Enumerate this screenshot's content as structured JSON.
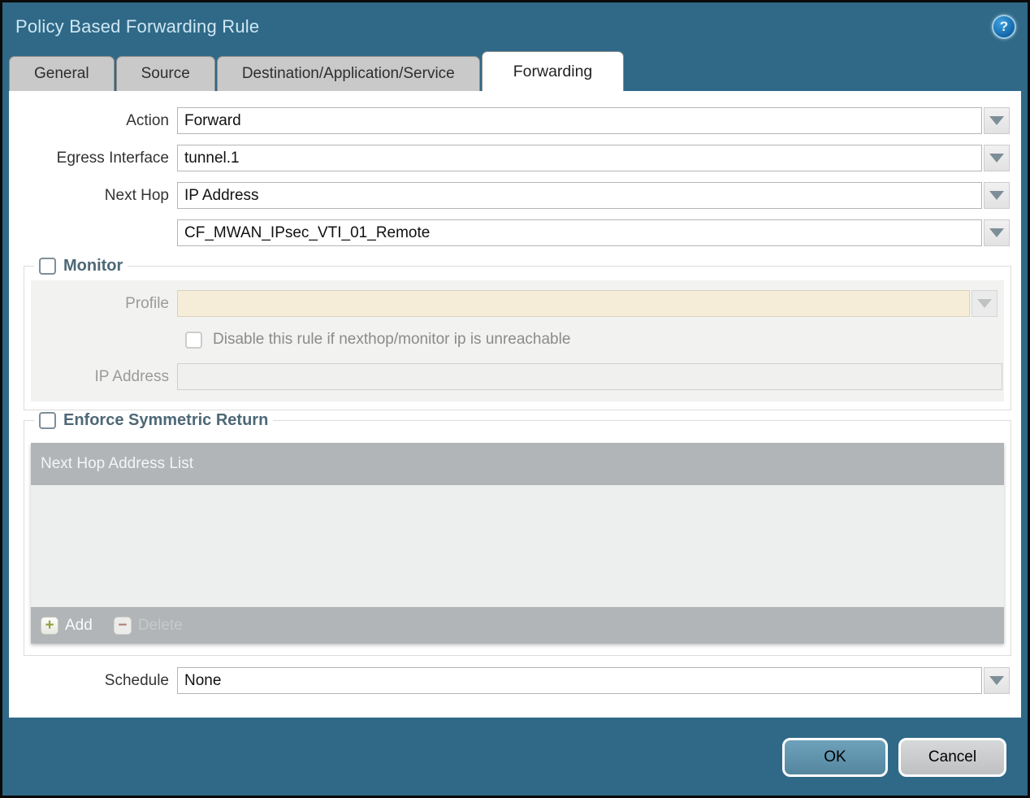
{
  "dialog": {
    "title": "Policy Based Forwarding Rule"
  },
  "icons": {
    "help_glyph": "?",
    "add_glyph": "+",
    "delete_glyph": "−"
  },
  "tabs": [
    {
      "label": "General",
      "active": false
    },
    {
      "label": "Source",
      "active": false
    },
    {
      "label": "Destination/Application/Service",
      "active": false
    },
    {
      "label": "Forwarding",
      "active": true
    }
  ],
  "form": {
    "action": {
      "label": "Action",
      "value": "Forward"
    },
    "egress_interface": {
      "label": "Egress Interface",
      "value": "tunnel.1"
    },
    "next_hop": {
      "label": "Next Hop",
      "value": "IP Address"
    },
    "next_hop_address": {
      "value": "CF_MWAN_IPsec_VTI_01_Remote"
    },
    "schedule": {
      "label": "Schedule",
      "value": "None"
    }
  },
  "monitor": {
    "legend": "Monitor",
    "checked": false,
    "profile": {
      "label": "Profile",
      "value": ""
    },
    "disable_rule_checkbox": {
      "label": "Disable this rule if nexthop/monitor ip is unreachable",
      "checked": false
    },
    "ip_address": {
      "label": "IP Address",
      "value": ""
    }
  },
  "enforce_symmetric_return": {
    "legend": "Enforce Symmetric Return",
    "checked": false,
    "table": {
      "header": "Next Hop Address List",
      "rows": [],
      "add_label": "Add",
      "delete_label": "Delete"
    }
  },
  "footer": {
    "ok_label": "OK",
    "cancel_label": "Cancel"
  },
  "colors": {
    "titlebar_teal": "#2f6987",
    "active_tab_bg": "#ffffff",
    "inactive_tab_bg": "#c9c9c9",
    "legend_slate": "#4e6876",
    "disabled_field_cream": "#f6edd8",
    "table_bar_gray": "#b1b5b7",
    "ok_button_blue": "#5e93ad",
    "cancel_button_gray": "#c9cacb"
  }
}
